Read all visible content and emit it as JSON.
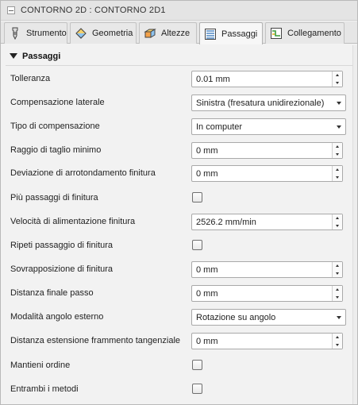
{
  "title": "CONTORNO 2D : CONTORNO 2D1",
  "tabs": [
    {
      "label": "Strumento",
      "icon": "tool-icon"
    },
    {
      "label": "Geometria",
      "icon": "geometry-icon"
    },
    {
      "label": "Altezze",
      "icon": "heights-icon"
    },
    {
      "label": "Passaggi",
      "icon": "passes-icon"
    },
    {
      "label": "Collegamento",
      "icon": "linking-icon"
    }
  ],
  "active_tab": "Passaggi",
  "section": {
    "title": "Passaggi"
  },
  "fields": {
    "tolleranza": {
      "label": "Tolleranza",
      "value": "0.01 mm"
    },
    "compensazione_laterale": {
      "label": "Compensazione laterale",
      "value": "Sinistra (fresatura unidirezionale)"
    },
    "tipo_compensazione": {
      "label": "Tipo di compensazione",
      "value": "In computer"
    },
    "raggio_taglio_minimo": {
      "label": "Raggio di taglio minimo",
      "value": "0 mm"
    },
    "deviazione_arrotondamento": {
      "label": "Deviazione di arrotondamento finitura",
      "value": "0 mm"
    },
    "piu_passaggi_finitura": {
      "label": "Più passaggi di finitura",
      "checked": false
    },
    "velocita_alimentazione": {
      "label": "Velocità di alimentazione finitura",
      "value": "2526.2 mm/min"
    },
    "ripeti_passaggio": {
      "label": "Ripeti passaggio di finitura",
      "checked": false
    },
    "sovrapposizione": {
      "label": "Sovrapposizione di finitura",
      "value": "0 mm"
    },
    "distanza_finale": {
      "label": "Distanza finale passo",
      "value": "0 mm"
    },
    "modalita_angolo": {
      "label": "Modalità angolo esterno",
      "value": "Rotazione su angolo"
    },
    "distanza_estensione": {
      "label": "Distanza estensione frammento tangenziale",
      "value": "0 mm"
    },
    "mantieni_ordine": {
      "label": "Mantieni ordine",
      "checked": false
    },
    "entrambi_metodi": {
      "label": "Entrambi i metodi",
      "checked": false
    }
  },
  "colors": {
    "accent": "#2a7fd4",
    "panel": "#f2f2f2",
    "tab_active": "#f7f7f7"
  }
}
